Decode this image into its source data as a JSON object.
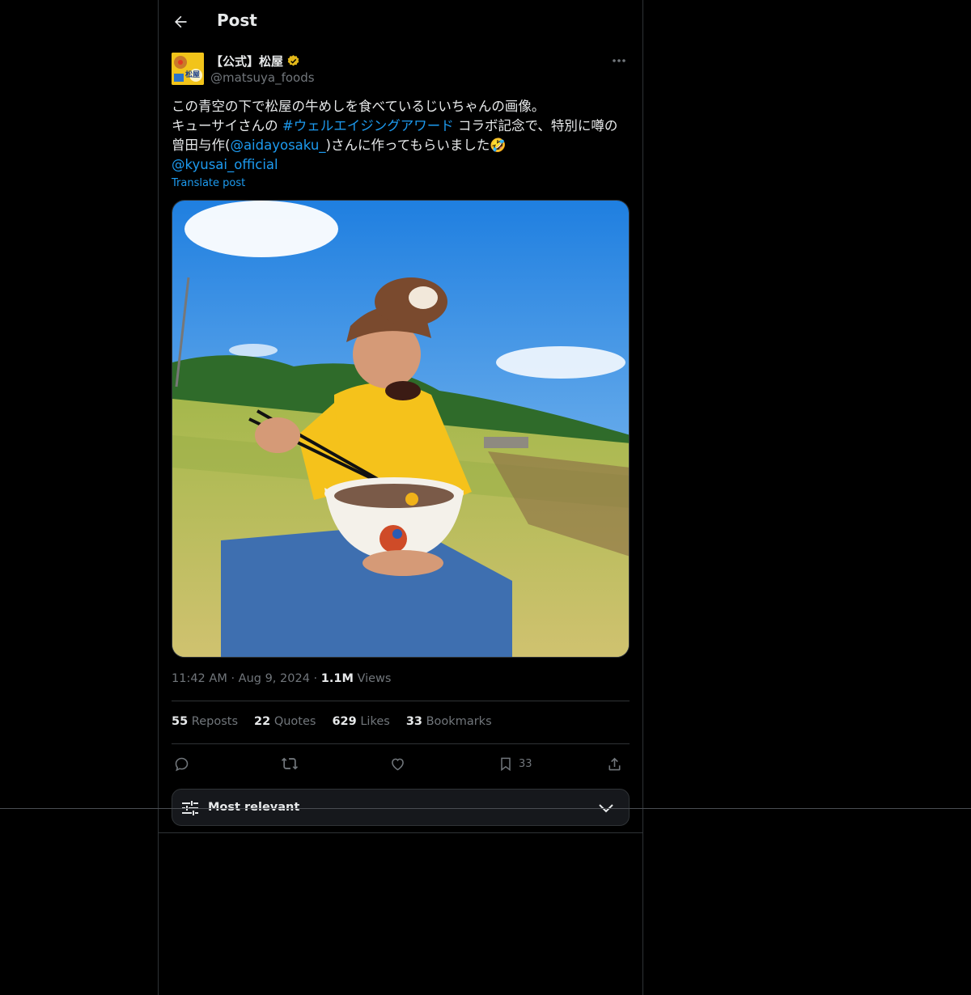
{
  "header": {
    "title": "Post"
  },
  "author": {
    "display_name": "【公式】松屋",
    "handle": "@matsuya_foods",
    "avatar_text": "松屋"
  },
  "tweet": {
    "line1": "この青空の下で松屋の牛めしを食べているじいちゃんの画像。",
    "line2_prefix": "キューサイさんの ",
    "line2_hashtag": "#ウェルエイジングアワード",
    "line2_suffix": " コラボ記念で、特別に噂の",
    "line3_prefix": "曾田与作(",
    "line3_mention": "@aidayosaku_",
    "line3_suffix": ")さんに作ってもらいました",
    "line3_emoji": "🤣",
    "line4_mention": "@kyusai_official",
    "translate_label": "Translate post"
  },
  "meta": {
    "time": "11:42 AM",
    "date": "Aug 9, 2024",
    "views_count": "1.1M",
    "views_label": "Views"
  },
  "stats": {
    "reposts_count": "55",
    "reposts_label": "Reposts",
    "quotes_count": "22",
    "quotes_label": "Quotes",
    "likes_count": "629",
    "likes_label": "Likes",
    "bookmarks_count": "33",
    "bookmarks_label": "Bookmarks"
  },
  "actions": {
    "bookmark_count": "33"
  },
  "sort": {
    "label": "Most relevant"
  },
  "colors": {
    "link": "#1d9bf0",
    "verified": "#e2b719",
    "background": "#000000"
  },
  "icons": [
    "back-arrow-icon",
    "verified-badge-icon",
    "more-icon",
    "reply-icon",
    "repost-icon",
    "like-icon",
    "bookmark-icon",
    "share-icon",
    "sliders-icon",
    "chevron-down-icon"
  ]
}
